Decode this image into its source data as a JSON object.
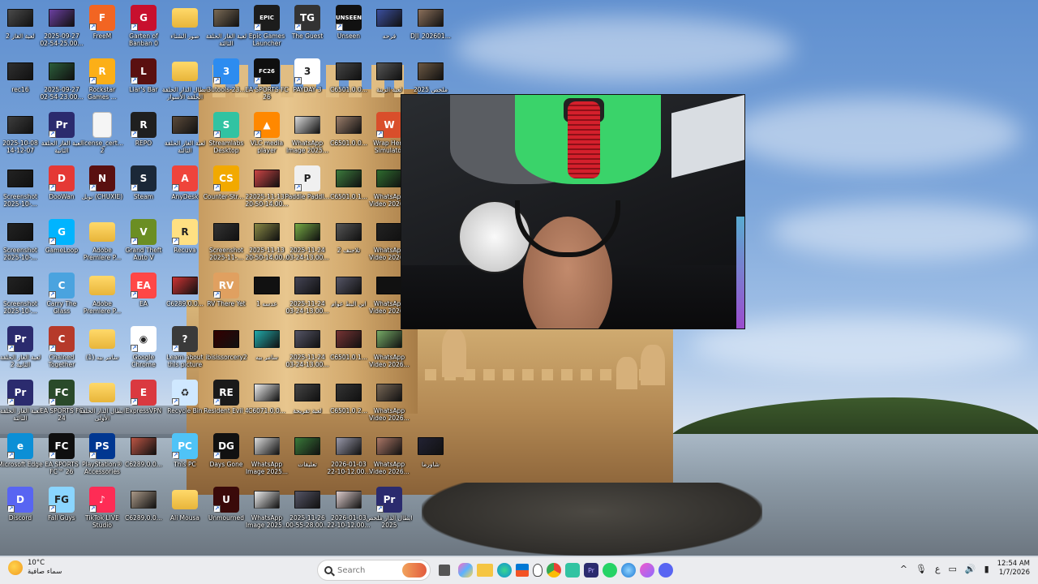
{
  "desktop": {
    "icons": [
      {
        "label": "لعبة الغاز 2",
        "kind": "thumb",
        "color": "#4a4a4a"
      },
      {
        "label": "2025-09-27 02-54-25.00...",
        "kind": "thumb",
        "color": "#6b3fa0"
      },
      {
        "label": "FreeM",
        "kind": "app",
        "color": "#f26522",
        "glyph": "F"
      },
      {
        "label": "Garten of Banban 0",
        "kind": "app",
        "color": "#c8102e",
        "glyph": "G"
      },
      {
        "label": "صور الشتاء",
        "kind": "folder",
        "color": "#f5c542"
      },
      {
        "label": "لعبة الغاز الحلقة الثالثة",
        "kind": "thumb",
        "color": "#7a6a55"
      },
      {
        "label": "Epic Games Launcher",
        "kind": "app",
        "color": "#1c1c1c",
        "glyph": "EPIC"
      },
      {
        "label": "The Guest",
        "kind": "app",
        "color": "#333333",
        "glyph": "TG"
      },
      {
        "label": "Unseen",
        "kind": "app",
        "color": "#111111",
        "glyph": "UNSEEN"
      },
      {
        "label": "فرحه",
        "kind": "thumb",
        "color": "#3b4f9e"
      },
      {
        "label": "DJI_202601...",
        "kind": "thumb",
        "color": "#8a6f5a"
      },
      {
        "label": "rec16",
        "kind": "thumb",
        "color": "#2f2f2f"
      },
      {
        "label": "2025-09-27 02-54-23.00...",
        "kind": "thumb",
        "color": "#2b5d3a"
      },
      {
        "label": "Rockstar Games ...",
        "kind": "app",
        "color": "#fcaf17",
        "glyph": "R"
      },
      {
        "label": "Liar's Bar",
        "kind": "app",
        "color": "#5a1010",
        "glyph": "L"
      },
      {
        "label": "ابطال الدار الحلقة الحلقة الأسوار",
        "kind": "folder",
        "color": "#f5c542"
      },
      {
        "label": "3utools-23...",
        "kind": "app",
        "color": "#2d8cf0",
        "glyph": "3"
      },
      {
        "label": "EA SPORTS FC 26",
        "kind": "app",
        "color": "#0f0f0f",
        "glyph": "FC26"
      },
      {
        "label": "PAYDAY 3",
        "kind": "app",
        "color": "#ffffff",
        "glyph": "3"
      },
      {
        "label": "C6501.0.0...",
        "kind": "thumb",
        "color": "#444"
      },
      {
        "label": "لعبة الزينة",
        "kind": "thumb",
        "color": "#555"
      },
      {
        "label": "ملخص 2025",
        "kind": "thumb",
        "color": "#6c5843"
      },
      {
        "label": "2025-10-08 14-12-07",
        "kind": "thumb",
        "color": "#3d3d3d"
      },
      {
        "label": "لعبة الغاز الحلقة الثانية",
        "kind": "app",
        "color": "#2b2b6e",
        "glyph": "Pr"
      },
      {
        "label": "license_cert... 2",
        "kind": "doc",
        "color": "#f5f5f5"
      },
      {
        "label": "REPO",
        "kind": "app",
        "color": "#1f1f1f",
        "glyph": "R"
      },
      {
        "label": "لعبة الغاز الحلقة الثالثة",
        "kind": "thumb",
        "color": "#5b4a3a"
      },
      {
        "label": "Streamlabs Desktop",
        "kind": "app",
        "color": "#31c3a2",
        "glyph": "S"
      },
      {
        "label": "VLC media player",
        "kind": "app",
        "color": "#ff8800",
        "glyph": "▲"
      },
      {
        "label": "WhatsApp Image 2025...",
        "kind": "thumb",
        "color": "#dadada"
      },
      {
        "label": "C6501.0.0...",
        "kind": "thumb",
        "color": "#9a7d6a"
      },
      {
        "label": "Wrap Hero Simulator",
        "kind": "app",
        "color": "#d94e2b",
        "glyph": "W"
      },
      {
        "label": "Screenshot 2025-10-...",
        "kind": "thumb",
        "color": "#222"
      },
      {
        "label": "DooWan",
        "kind": "app",
        "color": "#e53935",
        "glyph": "D"
      },
      {
        "label": "نوبل (CHUXIE)",
        "kind": "app",
        "color": "#5a1010",
        "glyph": "N"
      },
      {
        "label": "Steam",
        "kind": "app",
        "color": "#1b2838",
        "glyph": "S"
      },
      {
        "label": "AnyDesk",
        "kind": "app",
        "color": "#ef443b",
        "glyph": "A"
      },
      {
        "label": "Counter-Str... 2",
        "kind": "app",
        "color": "#f2a900",
        "glyph": "CS"
      },
      {
        "label": "2025-11-13 20-50-14.00...",
        "kind": "thumb",
        "color": "#c44"
      },
      {
        "label": "Paddle Paddl...",
        "kind": "app",
        "color": "#f0f0f0",
        "glyph": "P"
      },
      {
        "label": "C6501.0.1...",
        "kind": "thumb",
        "color": "#3c7a3c"
      },
      {
        "label": "WhatsApp Video 2026...",
        "kind": "thumb",
        "color": "#2e6b2e"
      },
      {
        "label": "Screenshot 2025-10-...",
        "kind": "thumb",
        "color": "#222"
      },
      {
        "label": "GameLoop",
        "kind": "app",
        "color": "#00b4ff",
        "glyph": "G"
      },
      {
        "label": "Adobe Premiere P...",
        "kind": "folder",
        "color": "#f5c542"
      },
      {
        "label": "Grand Theft Auto V",
        "kind": "app",
        "color": "#6b8e23",
        "glyph": "V"
      },
      {
        "label": "Recuva",
        "kind": "app",
        "color": "#ffe082",
        "glyph": "R"
      },
      {
        "label": "Screenshot 2025-11-...",
        "kind": "thumb",
        "color": "#333"
      },
      {
        "label": "2025-11-13 20-50-14.00...",
        "kind": "thumb",
        "color": "#884"
      },
      {
        "label": "2025-11-24 03-24-13.00...",
        "kind": "thumb",
        "color": "#7a4"
      },
      {
        "label": "تلاجنف 2",
        "kind": "thumb",
        "color": "#555"
      },
      {
        "label": "WhatsApp Video 2026...",
        "kind": "thumb",
        "color": "#222"
      },
      {
        "label": "Screenshot 2025-10-...",
        "kind": "thumb",
        "color": "#222"
      },
      {
        "label": "Carry The Glass",
        "kind": "app",
        "color": "#4aa3df",
        "glyph": "C"
      },
      {
        "label": "Adobe Premiere P...",
        "kind": "folder",
        "color": "#f5c542"
      },
      {
        "label": "EA",
        "kind": "app",
        "color": "#ff4747",
        "glyph": "EA"
      },
      {
        "label": "C6289.0.0...",
        "kind": "thumb",
        "color": "#c33"
      },
      {
        "label": "RV There Yet",
        "kind": "app",
        "color": "#e0a060",
        "glyph": "RV"
      },
      {
        "label": "1 عدسه",
        "kind": "thumb",
        "color": "#111"
      },
      {
        "label": "2025-11-24 03-24-13.00...",
        "kind": "thumb",
        "color": "#445"
      },
      {
        "label": "ابن البط عوام",
        "kind": "thumb",
        "color": "#556"
      },
      {
        "label": "WhatsApp Video 2026...",
        "kind": "thumb",
        "color": "#111"
      },
      {
        "label": "لعبة الغاز الحلقة الثانية 2",
        "kind": "app",
        "color": "#2b2b6e",
        "glyph": "Pr"
      },
      {
        "label": "Chained Together",
        "kind": "app",
        "color": "#b63a2a",
        "glyph": "C"
      },
      {
        "label": "سامر بيه (1)",
        "kind": "folder",
        "color": "#f5c542"
      },
      {
        "label": "Google Chrome",
        "kind": "app",
        "color": "#ffffff",
        "glyph": "◉"
      },
      {
        "label": "Learn about this picture",
        "kind": "app",
        "color": "#3a3a3a",
        "glyph": "?"
      },
      {
        "label": "ibisissorcery2",
        "kind": "thumb",
        "color": "#300"
      },
      {
        "label": "سامر بيه",
        "kind": "thumb",
        "color": "#2aa"
      },
      {
        "label": "2025-11-24 03-24-13.00...",
        "kind": "thumb",
        "color": "#556"
      },
      {
        "label": "C6501.0.1...",
        "kind": "thumb",
        "color": "#733"
      },
      {
        "label": "WhatsApp Video 2026...",
        "kind": "thumb",
        "color": "#7a6"
      },
      {
        "label": "لعبة الغاز الحلقة الثالثة",
        "kind": "app",
        "color": "#2b2b6e",
        "glyph": "Pr"
      },
      {
        "label": "EA SPORTS FC 24",
        "kind": "app",
        "color": "#2a4a2a",
        "glyph": "FC"
      },
      {
        "label": "ابطال الدار الحلقة الأولى",
        "kind": "folder",
        "color": "#f5c542"
      },
      {
        "label": "ExpressVPN",
        "kind": "app",
        "color": "#da3940",
        "glyph": "E"
      },
      {
        "label": "Recycle Bin",
        "kind": "app",
        "color": "#cfe8ff",
        "glyph": "♻"
      },
      {
        "label": "Resident Evil 4",
        "kind": "app",
        "color": "#1a1a1a",
        "glyph": "RE"
      },
      {
        "label": "C6071.0.0...",
        "kind": "thumb",
        "color": "#eee"
      },
      {
        "label": "لعبة تفريحة",
        "kind": "thumb",
        "color": "#444"
      },
      {
        "label": "C6501.0.2...",
        "kind": "thumb",
        "color": "#333"
      },
      {
        "label": "WhatsApp Video 2026...",
        "kind": "thumb",
        "color": "#765"
      },
      {
        "label": "Microsoft Edge",
        "kind": "app",
        "color": "#0c8fd6",
        "glyph": "e"
      },
      {
        "label": "EA SPORTS FC™ 26",
        "kind": "app",
        "color": "#0f0f0f",
        "glyph": "FC"
      },
      {
        "label": "PlayStation® Accessories",
        "kind": "app",
        "color": "#003791",
        "glyph": "PS"
      },
      {
        "label": "C6289.0.0...",
        "kind": "thumb",
        "color": "#b54"
      },
      {
        "label": "This PC",
        "kind": "app",
        "color": "#4fc3f7",
        "glyph": "PC"
      },
      {
        "label": "Days Gone",
        "kind": "app",
        "color": "#111111",
        "glyph": "DG"
      },
      {
        "label": "WhatsApp Image 2025...",
        "kind": "thumb",
        "color": "#ddd"
      },
      {
        "label": "تعليقات",
        "kind": "thumb",
        "color": "#3a7a3a"
      },
      {
        "label": "2026-01-03 22-10-12.00...",
        "kind": "thumb",
        "color": "#99a"
      },
      {
        "label": "WhatsApp Video 2026...",
        "kind": "thumb",
        "color": "#a76"
      },
      {
        "label": "شاورما",
        "kind": "thumb",
        "color": "#223"
      },
      {
        "label": "Discord",
        "kind": "app",
        "color": "#5865f2",
        "glyph": "D"
      },
      {
        "label": "Fall Guys",
        "kind": "app",
        "color": "#8ad5ff",
        "glyph": "FG"
      },
      {
        "label": "TikTok LIVE Studio",
        "kind": "app",
        "color": "#fe2c55",
        "glyph": "♪"
      },
      {
        "label": "C6289.0.0...",
        "kind": "thumb",
        "color": "#a98"
      },
      {
        "label": "Ali Mousa",
        "kind": "folder",
        "color": "#f5c542"
      },
      {
        "label": "Unmourned",
        "kind": "app",
        "color": "#3a0a0a",
        "glyph": "U"
      },
      {
        "label": "WhatsApp Image 2025...",
        "kind": "thumb",
        "color": "#eee"
      },
      {
        "label": "2025-11-26 00-55-28.00...",
        "kind": "thumb",
        "color": "#556"
      },
      {
        "label": "2026-01-03 22-10-12.00...",
        "kind": "thumb",
        "color": "#dcc"
      },
      {
        "label": "ابطال الدار ملخص 2025",
        "kind": "app",
        "color": "#2b2b6e",
        "glyph": "Pr"
      }
    ]
  },
  "taskbar": {
    "weather": {
      "temp": "10°C",
      "condition": "سماء صافية"
    },
    "search_placeholder": "Search",
    "tray": {
      "lang": "ع",
      "time": "12:54 AM",
      "date": "1/7/2026"
    }
  },
  "colors": {
    "taskbar_bg": "#eeeef0",
    "folder": "#f5c542",
    "accent": "#0078d4"
  }
}
